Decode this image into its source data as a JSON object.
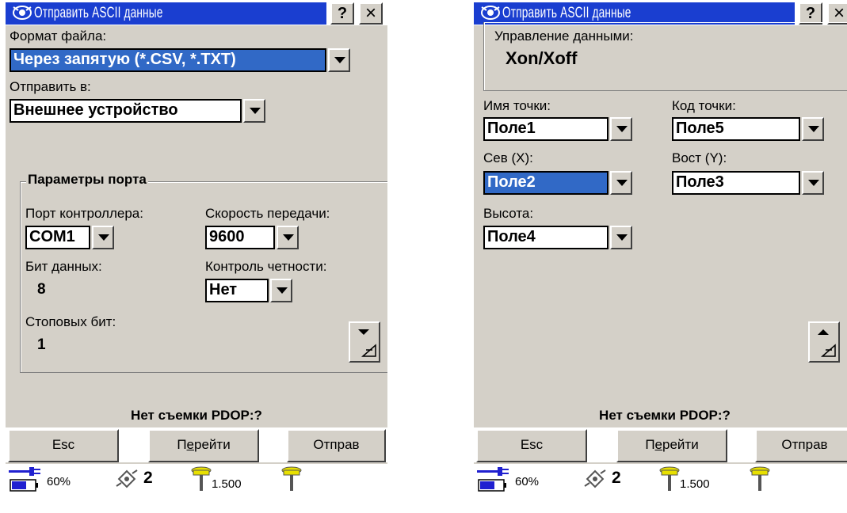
{
  "title": "Отправить ASCII данные",
  "help_label": "?",
  "close_label": "×",
  "screen1": {
    "file_format_label": "Формат файла:",
    "file_format_value": "Через запятую (*.CSV, *.TXT)",
    "send_to_label": "Отправить в:",
    "send_to_value": "Внешнее устройство",
    "port_group_title": "Параметры порта",
    "controller_port_label": "Порт контроллера:",
    "controller_port_value": "COM1",
    "baud_label": "Скорость передачи:",
    "baud_value": "9600",
    "data_bits_label": "Бит данных:",
    "data_bits_value": "8",
    "parity_label": "Контроль четности:",
    "parity_value": "Нет",
    "stop_bits_label": "Стоповых бит:",
    "stop_bits_value": "1"
  },
  "screen2": {
    "flow_control_label": "Управление данными:",
    "flow_control_value": "Xon/Xoff",
    "point_name_label": "Имя точки:",
    "point_name_value": "Поле1",
    "point_code_label": "Код точки:",
    "point_code_value": "Поле5",
    "north_label": "Сев  (X):",
    "north_value": "Поле2",
    "east_label": "Вост (Y):",
    "east_value": "Поле3",
    "height_label": "Высота:",
    "height_value": "Поле4"
  },
  "status": "Нет съемки  PDOP:?",
  "buttons": {
    "esc": "Esc",
    "go_prefix": "П",
    "go_ul": "е",
    "go_suffix": "рейти",
    "send": "Отправ"
  },
  "taskbar": {
    "battery": "60%",
    "satellites": "2",
    "antenna_height": "1.500"
  }
}
